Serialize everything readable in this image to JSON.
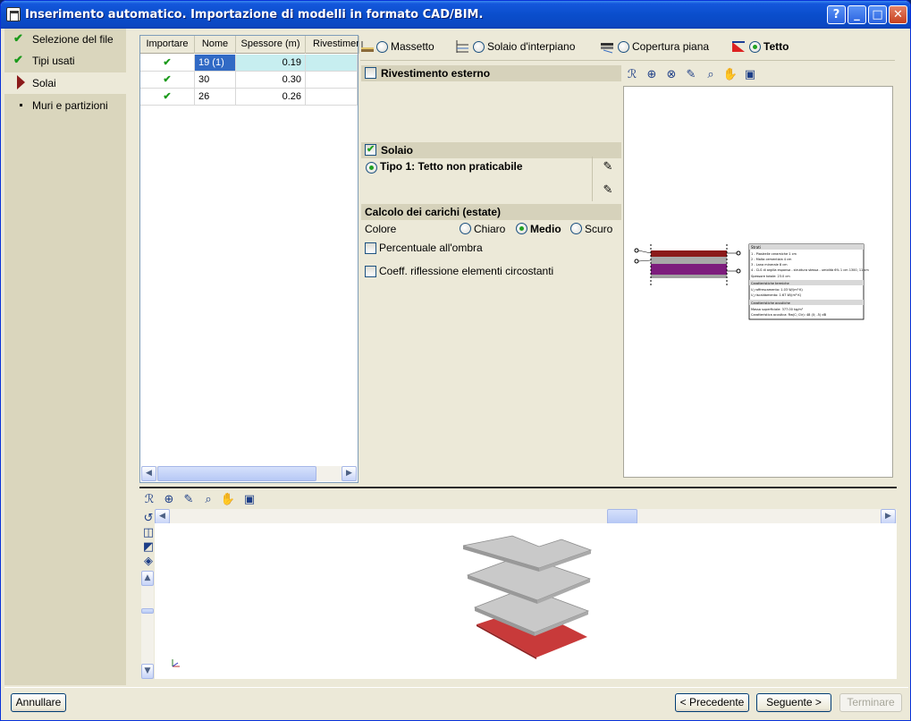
{
  "window": {
    "title": "Inserimento automatico. Importazione di modelli in formato CAD/BIM.",
    "buttons": {
      "help": "?",
      "minimize": "_",
      "maximize": "□",
      "close": "✕"
    }
  },
  "steps": [
    {
      "label": "Selezione del file",
      "state": "done"
    },
    {
      "label": "Tipi usati",
      "state": "done"
    },
    {
      "label": "Solai",
      "state": "current"
    },
    {
      "label": "Muri e partizioni",
      "state": "pending"
    }
  ],
  "table": {
    "headers": [
      "Importare",
      "Nome",
      "Spessore (m)",
      "Rivestimento"
    ],
    "rows": [
      {
        "import": "✔",
        "name": "19 (1)",
        "thickness": "0.19"
      },
      {
        "import": "✔",
        "name": "30",
        "thickness": "0.30"
      },
      {
        "import": "✔",
        "name": "26",
        "thickness": "0.26"
      }
    ]
  },
  "types": [
    {
      "label": "Massetto",
      "selected": false
    },
    {
      "label": "Solaio d'interpiano",
      "selected": false
    },
    {
      "label": "Copertura piana",
      "selected": false
    },
    {
      "label": "Tetto",
      "selected": true
    }
  ],
  "settings": {
    "external_cladding": {
      "label": "Rivestimento esterno",
      "checked": false
    },
    "slab": {
      "label": "Solaio",
      "checked": true
    },
    "slab_type": "Tipo 1: Tetto non praticabile",
    "loads_title": "Calcolo dei carichi (estate)",
    "color_label": "Colore",
    "color_options": [
      {
        "label": "Chiaro",
        "selected": false
      },
      {
        "label": "Medio",
        "selected": true
      },
      {
        "label": "Scuro",
        "selected": false
      }
    ],
    "shade_percent": {
      "label": "Percentuale all'ombra",
      "checked": false
    },
    "reflection_coeff": {
      "label": "Coeff. riflessione elementi circostanti",
      "checked": false
    }
  },
  "section_legend": {
    "title": "Strati",
    "layers": [
      "1 - Piastrelle ceramiche 1 cm",
      "2 - Malta cementizia 4 cm",
      "3 - Lana minerale 8 cm",
      "4 - CLS di argilla espansa - struttura stessa - umidità 6% 1 cm 1300, 11 cm",
      "Spessore totale: 23.0 cm"
    ],
    "thermal_title": "Caratteristiche termiche",
    "thermal": [
      "U_raffrescamento: 1.03 W/(m²·K)",
      "U_riscaldamento: 1.67 W/(m²·K)"
    ],
    "acoustic_title": "Caratteristiche acustiche",
    "acoustic": [
      "Massa superficiale: 377.00 kg/m²",
      "Caratteristica acustica: Rw(C; Ctr): 48 (0; -5) dB"
    ]
  },
  "buttons": {
    "cancel": "Annullare",
    "previous": "< Precedente",
    "next": "Seguente >",
    "finish": "Terminare"
  },
  "colors": {
    "titlebar": "#0a4ecc",
    "selection": "#316ac5",
    "selected_row_cells": "#c7eef0",
    "check_green": "#1b9a1b",
    "slab_red": "#c83a3a",
    "slab_grey": "#c0c0c0"
  }
}
